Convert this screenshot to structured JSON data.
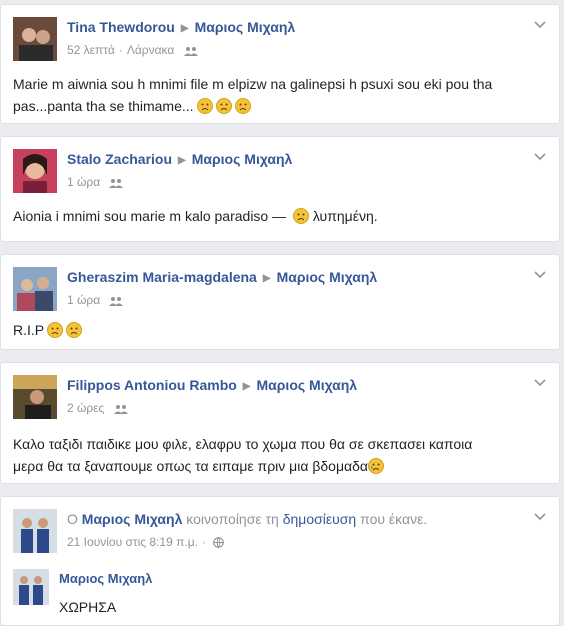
{
  "posts": [
    {
      "author": "Tina Thewdorou",
      "target": "Μαριος Μιχαηλ",
      "time": "52 λεπτά",
      "location": "Λάρνακα",
      "text": "Marie m aiwnia sou h mnimi file m elpizw na galinepsi h psuxi sou eki pou tha pas...panta tha se thimame..."
    },
    {
      "author": "Stalo Zachariou",
      "target": "Μαριος Μιχαηλ",
      "time": "1 ώρα",
      "text": "Aionia i mnimi sou marie m kalo paradiso —",
      "feeling": "λυπημένη."
    },
    {
      "author": "Gheraszim Maria-magdalena",
      "target": "Μαριος Μιχαηλ",
      "time": "1 ώρα",
      "text": "R.I.P"
    },
    {
      "author": "Filippos Antoniou Rambo",
      "target": "Μαριος Μιχαηλ",
      "time": "2 ώρες",
      "text_line1": "Καλο ταξιδι παιδικε μου φιλε, ελαφρυ το χωμα που θα σε σκεπασει καποια",
      "text_line2": "μερα θα τα ξαναπουμε οπως τα ειπαμε πριν μια βδομαδα"
    }
  ],
  "share": {
    "prefix": "Ο",
    "author": "Μαριος Μιχαηλ",
    "action": "κοινοποίησε τη",
    "object": "δημοσίευση",
    "suffix": "που έκανε.",
    "date": "21 Ιουνίου στις 8:19 π.μ.",
    "inner_author": "Μαριος Μιχαηλ",
    "inner_text": "ΧΩΡΗΣΑ"
  },
  "icons": {
    "audience": "friends-icon",
    "public": "globe-icon",
    "menu": "chevron-down-icon",
    "emoji": "sad-face-icon",
    "crying": "crying-face-icon"
  },
  "colors": {
    "link": "#365899",
    "meta": "#90949c",
    "background": "#e9ebee"
  }
}
